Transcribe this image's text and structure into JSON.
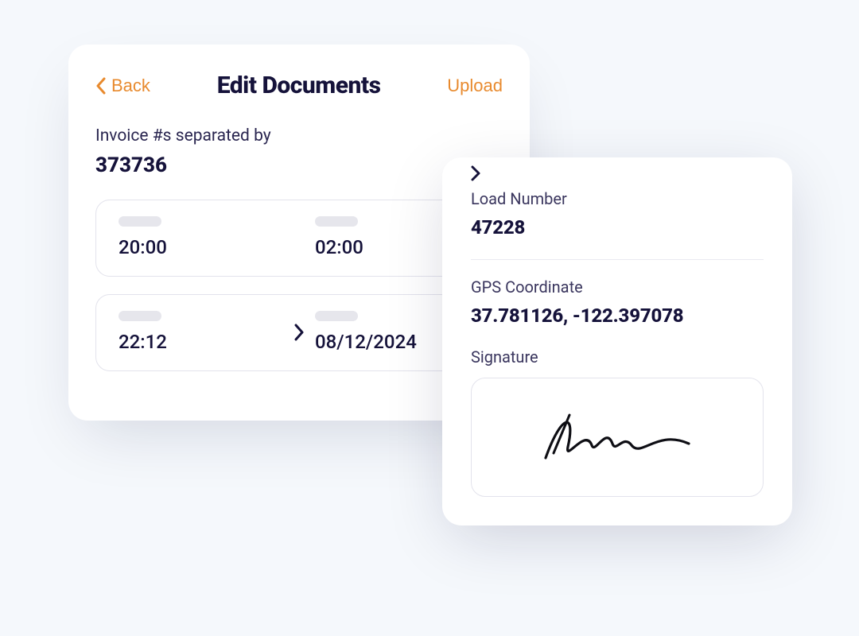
{
  "colors": {
    "accent": "#E88A2E",
    "text": "#15123A"
  },
  "edit_card": {
    "back_label": "Back",
    "title": "Edit Documents",
    "upload_label": "Upload",
    "invoice_label": "Invoice #s separated by",
    "invoice_value": "373736",
    "row1": {
      "left": "20:00",
      "right": "02:00"
    },
    "row2": {
      "left": "22:12",
      "right": "08/12/2024"
    }
  },
  "details_card": {
    "load_label": "Load Number",
    "load_value": "47228",
    "gps_label": "GPS Coordinate",
    "gps_value": "37.781126, -122.397078",
    "signature_label": "Signature"
  }
}
